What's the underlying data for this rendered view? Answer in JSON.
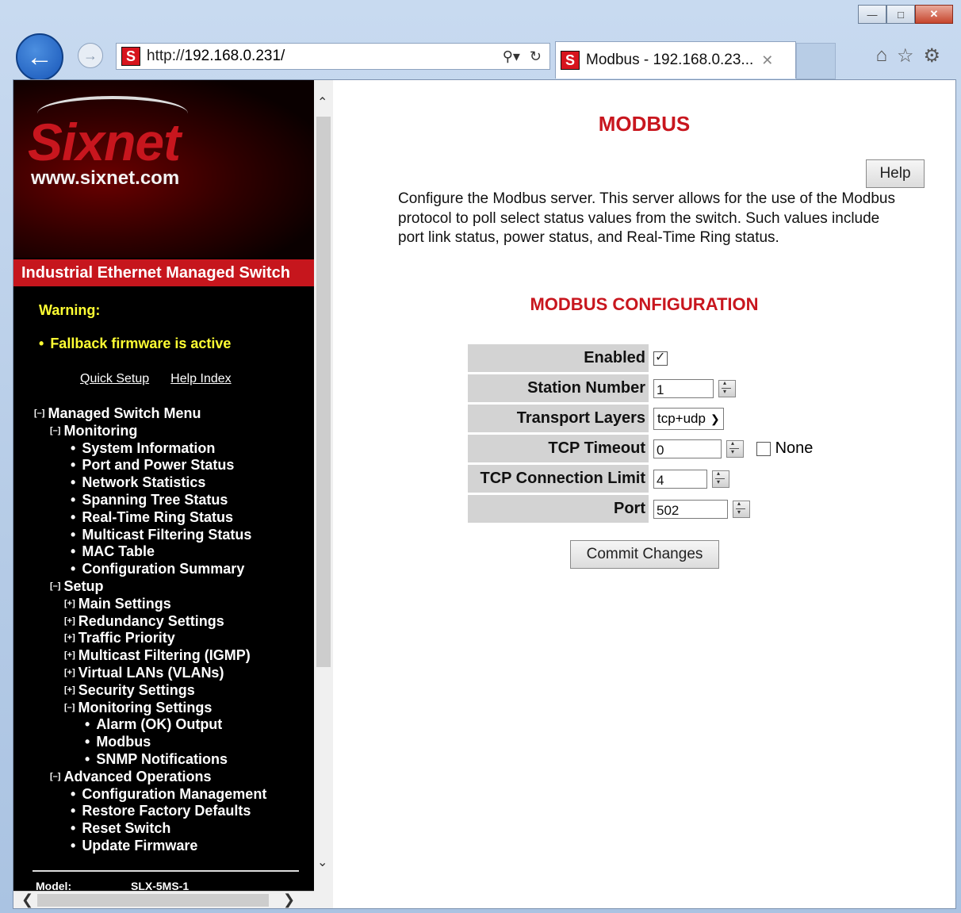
{
  "browser": {
    "url_prefix": "http://",
    "url_host": "192.168.0.231/",
    "tab_title": "Modbus - 192.168.0.23...",
    "tab_close": "✕",
    "favicon_letter": "S",
    "icons": [
      "back-icon",
      "forward-icon",
      "search-icon",
      "refresh-icon",
      "home-icon",
      "favorites-star-icon",
      "settings-gear-icon"
    ]
  },
  "logo": {
    "brand": "Sixnet",
    "url": "www.sixnet.com",
    "tagline": "Industrial Ethernet Managed Switch"
  },
  "warning": {
    "title": "Warning:",
    "message": "Fallback firmware is active"
  },
  "quick_links": {
    "quick_setup": "Quick Setup",
    "help_index": "Help Index"
  },
  "menu": {
    "root": "Managed Switch Menu",
    "monitoring": {
      "label": "Monitoring",
      "items": [
        "System Information",
        "Port and Power Status",
        "Network Statistics",
        "Spanning Tree Status",
        "Real-Time Ring Status",
        "Multicast Filtering Status",
        "MAC Table",
        "Configuration Summary"
      ]
    },
    "setup": {
      "label": "Setup",
      "items": [
        "Main Settings",
        "Redundancy Settings",
        "Traffic Priority",
        "Multicast Filtering (IGMP)",
        "Virtual LANs (VLANs)",
        "Security Settings"
      ],
      "monitoring_settings": {
        "label": "Monitoring Settings",
        "items": [
          "Alarm (OK) Output",
          "Modbus",
          "SNMP Notifications"
        ]
      }
    },
    "advanced": {
      "label": "Advanced Operations",
      "items": [
        "Configuration Management",
        "Restore Factory Defaults",
        "Reset Switch",
        "Update Firmware"
      ]
    },
    "model_label": "Model:",
    "model_value": "SLX-5MS-1"
  },
  "page": {
    "title": "MODBUS",
    "help_button": "Help",
    "description": "Configure the Modbus server. This server allows for the use of the Modbus protocol to poll select status values from the switch. Such values include port link status, power status, and Real-Time Ring status.",
    "section_title": "MODBUS CONFIGURATION",
    "fields": {
      "enabled_label": "Enabled",
      "enabled_checked": true,
      "station_label": "Station Number",
      "station_value": "1",
      "transport_label": "Transport Layers",
      "transport_value": "tcp+udp",
      "timeout_label": "TCP Timeout",
      "timeout_value": "0",
      "timeout_none_label": "None",
      "timeout_none_checked": false,
      "conn_limit_label": "TCP Connection Limit",
      "conn_limit_value": "4",
      "port_label": "Port",
      "port_value": "502"
    },
    "commit_button": "Commit Changes"
  },
  "colors": {
    "accent_red": "#c8161e",
    "warning_yellow": "#ffff33",
    "menu_bg": "#000000",
    "label_bg": "#d3d3d3"
  }
}
